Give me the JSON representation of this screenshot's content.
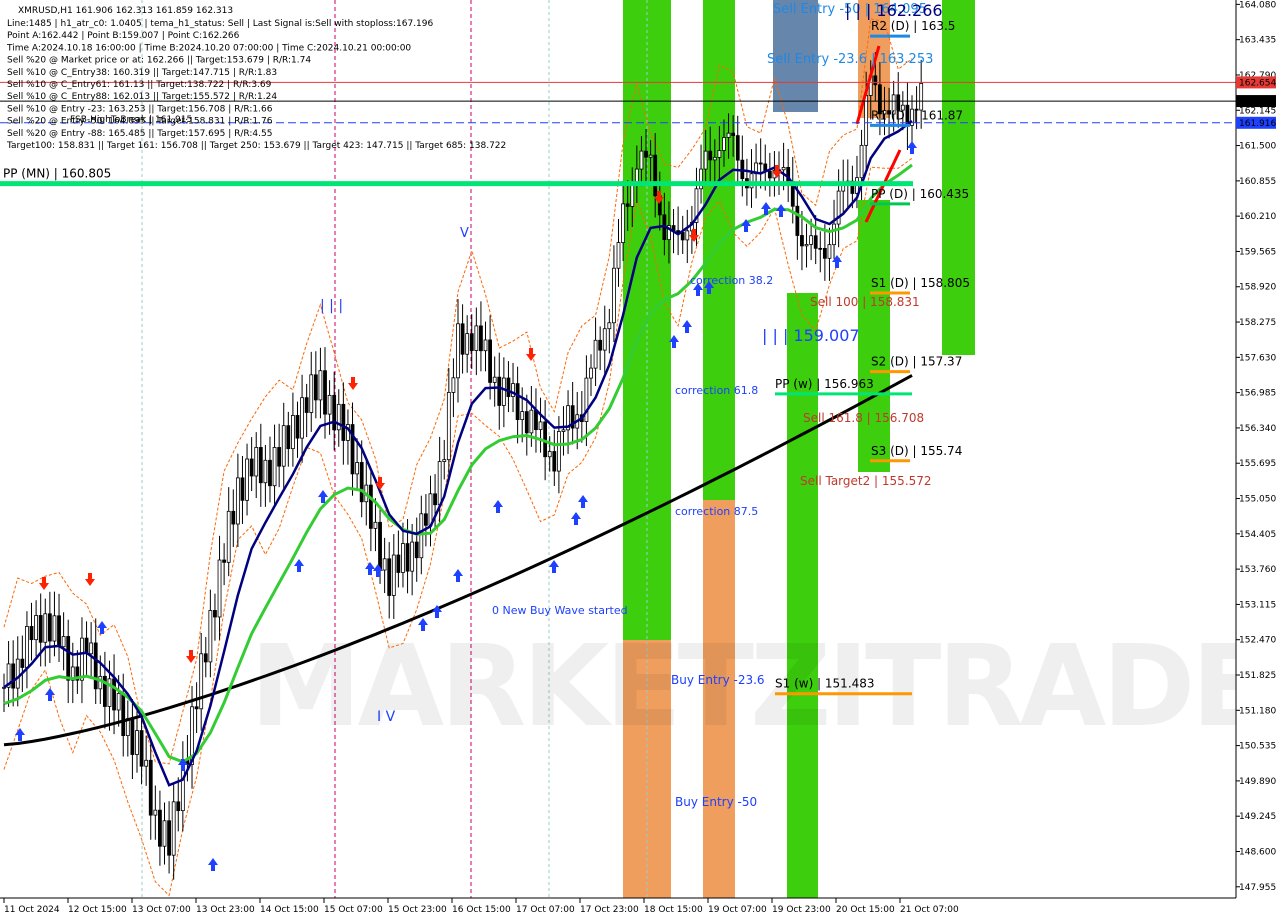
{
  "symbol_line": "XMRUSD,H1  161.906 162.313 161.859 162.313",
  "info_lines": [
    "Line:1485 | h1_atr_c0: 1.0405 | tema_h1_status: Sell | Last Signal is:Sell with stoploss:167.196",
    "Point A:162.442 | Point B:159.007 | Point C:162.266",
    "Time A:2024.10.18 16:00:00 | Time B:2024.10.20 07:00:00 | Time C:2024.10.21 00:00:00",
    "Sell %20 @ Market price or at: 162.266 || Target:153.679 | R/R:1.74",
    "Sell %10 @ C_Entry38: 160.319 || Target:147.715 | R/R:1.83",
    "Sell %10 @ C_Entry61: 161.13 || Target:138.722 | R/R:3.69",
    "Sell %10 @ C_Entry88: 162.013 || Target:155.572 | R/R:1.24",
    "Sell %10 @ Entry -23: 163.253 || Target:156.708 | R/R:1.66",
    "Sell %20 @ Entry -50: 164.095 || Target:158.831 | R/R:1.76",
    "Sell %20 @ Entry -88: 165.485 || Target:157.695 | R/R:4.55",
    "Target100: 158.831 || Target 161: 156.708 || Target 250: 153.679 || Target 423: 147.715 || Target 685: 138.722"
  ],
  "overlay_text": "FSB-HighToBreak | 161.915",
  "watermark": "MARKETZITRADE",
  "price_axis": {
    "ticks": [
      "164.080",
      "163.435",
      "162.790",
      "162.145",
      "161.500",
      "160.855",
      "160.210",
      "159.565",
      "158.920",
      "158.275",
      "157.630",
      "156.985",
      "156.340",
      "155.695",
      "155.050",
      "154.405",
      "153.760",
      "153.115",
      "152.470",
      "151.825",
      "151.180",
      "150.535",
      "149.890",
      "149.245",
      "148.600",
      "147.955"
    ],
    "tick_values": [
      164.08,
      163.435,
      162.79,
      162.145,
      161.5,
      160.855,
      160.21,
      159.565,
      158.92,
      158.275,
      157.63,
      156.985,
      156.34,
      155.695,
      155.05,
      154.405,
      153.76,
      153.115,
      152.47,
      151.825,
      151.18,
      150.535,
      149.89,
      149.245,
      148.6,
      147.955
    ],
    "min": 147.75,
    "max": 164.16
  },
  "time_axis": [
    "11 Oct 2024",
    "12 Oct 15:00",
    "13 Oct 07:00",
    "13 Oct 23:00",
    "14 Oct 15:00",
    "15 Oct 07:00",
    "15 Oct 23:00",
    "16 Oct 15:00",
    "17 Oct 07:00",
    "17 Oct 23:00",
    "18 Oct 15:00",
    "19 Oct 07:00",
    "19 Oct 23:00",
    "20 Oct 15:00",
    "21 Oct 07:00"
  ],
  "price_tags": [
    {
      "label": "162.654",
      "value": 162.654,
      "color": "#e53935"
    },
    {
      "label": "162.313",
      "value": 162.313,
      "color": "#000000"
    },
    {
      "label": "161.916",
      "value": 161.916,
      "color": "#1e40ff"
    }
  ],
  "levels": [
    {
      "label": "PP (MN) | 160.805",
      "value": 160.805,
      "color": "#00e676"
    },
    {
      "label": "R2 (D) | 163.5",
      "value": 163.5,
      "color": "#1e88e5"
    },
    {
      "label": "R1 (D) | 161.87",
      "value": 161.87,
      "color": "#1e88e5"
    },
    {
      "label": "PP (D) | 160.435",
      "value": 160.435,
      "color": "#00c853"
    },
    {
      "label": "S1 (D) | 158.805",
      "value": 158.805,
      "color": "#ff9800"
    },
    {
      "label": "S2 (D) | 157.37",
      "value": 157.37,
      "color": "#ff9800"
    },
    {
      "label": "S3 (D) | 155.74",
      "value": 155.74,
      "color": "#ff9800"
    },
    {
      "label": "PP (w) | 156.963",
      "value": 156.963,
      "color": "#00e676"
    },
    {
      "label": "S1 (w) | 151.483",
      "value": 151.483,
      "color": "#ff9800"
    }
  ],
  "annotations": [
    {
      "text": "Sell Entry -50 | 164.095",
      "color": "#1e88e5"
    },
    {
      "text": "| | | 162.266",
      "color": "#000080"
    },
    {
      "text": "Sell Entry -23.6 | 163.253",
      "color": "#1e88e5"
    },
    {
      "text": "Sell 100 | 158.831",
      "color": "#c0392b"
    },
    {
      "text": "| | | 159.007",
      "color": "#1e40ff"
    },
    {
      "text": "Sell 161.8 | 156.708",
      "color": "#c0392b"
    },
    {
      "text": "Sell Target2 | 155.572",
      "color": "#c0392b"
    },
    {
      "text": "correction 38.2",
      "color": "#1e40ff"
    },
    {
      "text": "correction 61.8",
      "color": "#1e40ff"
    },
    {
      "text": "correction 87.5",
      "color": "#1e40ff"
    },
    {
      "text": "0 New Buy Wave started",
      "color": "#1e40ff"
    },
    {
      "text": "Buy Entry -23.6",
      "color": "#1e40ff"
    },
    {
      "text": "Buy Entry -50",
      "color": "#1e40ff"
    },
    {
      "text": "| | |",
      "color": "#1e40ff"
    },
    {
      "text": "V",
      "color": "#1e40ff"
    },
    {
      "text": "I V",
      "color": "#1e40ff"
    }
  ],
  "colors": {
    "green_zone": "#33cc00",
    "orange_zone": "#ee9955",
    "candle": "#000000",
    "ma_fast": "#000080",
    "ma_mid": "#33cc33",
    "ma_slow": "#000000",
    "envelope": "#ff6600"
  },
  "chart_data": {
    "type": "candlestick",
    "symbol": "XMRUSD",
    "timeframe": "H1",
    "ylim": [
      147.75,
      164.16
    ],
    "x": [
      "11 Oct 2024",
      "12 Oct 15:00",
      "13 Oct 07:00",
      "13 Oct 23:00",
      "14 Oct 15:00",
      "15 Oct 07:00",
      "15 Oct 23:00",
      "16 Oct 15:00",
      "17 Oct 07:00",
      "17 Oct 23:00",
      "18 Oct 15:00",
      "19 Oct 07:00",
      "19 Oct 23:00",
      "20 Oct 15:00",
      "21 Oct 07:00"
    ],
    "close_path": [
      151.6,
      152.1,
      152.5,
      152.9,
      152.4,
      151.9,
      152.3,
      151.7,
      151.3,
      150.9,
      150.3,
      149.2,
      148.7,
      150.1,
      151.4,
      152.8,
      154.1,
      155.2,
      155.7,
      155.5,
      155.9,
      156.3,
      156.9,
      157.1,
      156.6,
      156.1,
      155.3,
      154.3,
      153.6,
      153.9,
      154.3,
      154.8,
      156.1,
      157.9,
      158.1,
      157.6,
      157.1,
      156.8,
      156.6,
      156.1,
      155.9,
      156.4,
      156.8,
      157.6,
      158.6,
      160.1,
      161.4,
      161.0,
      160.1,
      159.6,
      160.4,
      161.1,
      161.7,
      161.4,
      161.0,
      160.9,
      161.3,
      160.6,
      159.9,
      159.4,
      159.9,
      160.6,
      161.1,
      162.6,
      162.3,
      162.0,
      162.3
    ],
    "series": [
      {
        "name": "PP (MN)",
        "value": 160.805
      },
      {
        "name": "PP (D)",
        "value": 160.435
      },
      {
        "name": "R1 (D)",
        "value": 161.87
      },
      {
        "name": "R2 (D)",
        "value": 163.5
      },
      {
        "name": "S1 (D)",
        "value": 158.805
      },
      {
        "name": "S2 (D)",
        "value": 157.37
      },
      {
        "name": "S3 (D)",
        "value": 155.74
      },
      {
        "name": "PP (w)",
        "value": 156.963
      },
      {
        "name": "S1 (w)",
        "value": 151.483
      }
    ]
  }
}
